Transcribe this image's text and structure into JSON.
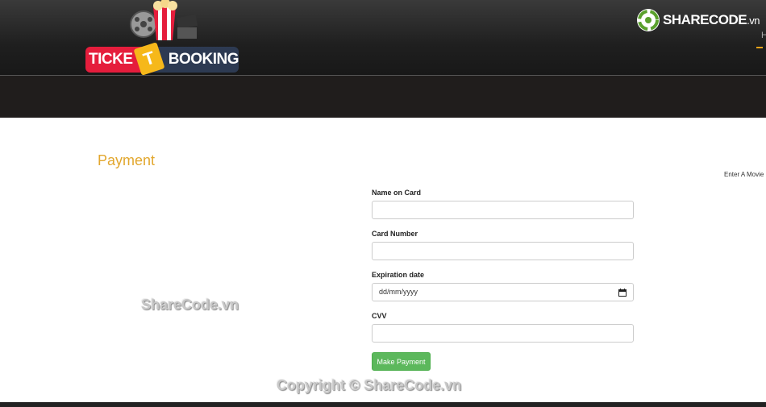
{
  "header": {
    "logo": {
      "left_text": "TICKE",
      "ticket_glyph": "T",
      "right_text": "BOOKING",
      "popcorn_label": "POP"
    },
    "brand": {
      "name": "SHARECODE",
      "suffix": ".vn",
      "icon": "recycle-icon"
    },
    "nav": {
      "partial_item": "H"
    },
    "search": {
      "placeholder": "Enter A Movie Name"
    }
  },
  "page": {
    "title": "Payment"
  },
  "form": {
    "name_label": "Name on Card",
    "card_label": "Card Number",
    "exp_label": "Expiration date",
    "exp_placeholder": "dd/mm/yyyy",
    "cvv_label": "CVV",
    "submit_label": "Make Payment"
  },
  "watermarks": {
    "center": "ShareCode.vn",
    "bottom": "Copyright © ShareCode.vn"
  },
  "colors": {
    "accent": "#e2a72e",
    "button": "#5cb85c",
    "header": "#201d1c",
    "logo_red": "#e51d3c",
    "logo_navy": "#2d3a52"
  }
}
